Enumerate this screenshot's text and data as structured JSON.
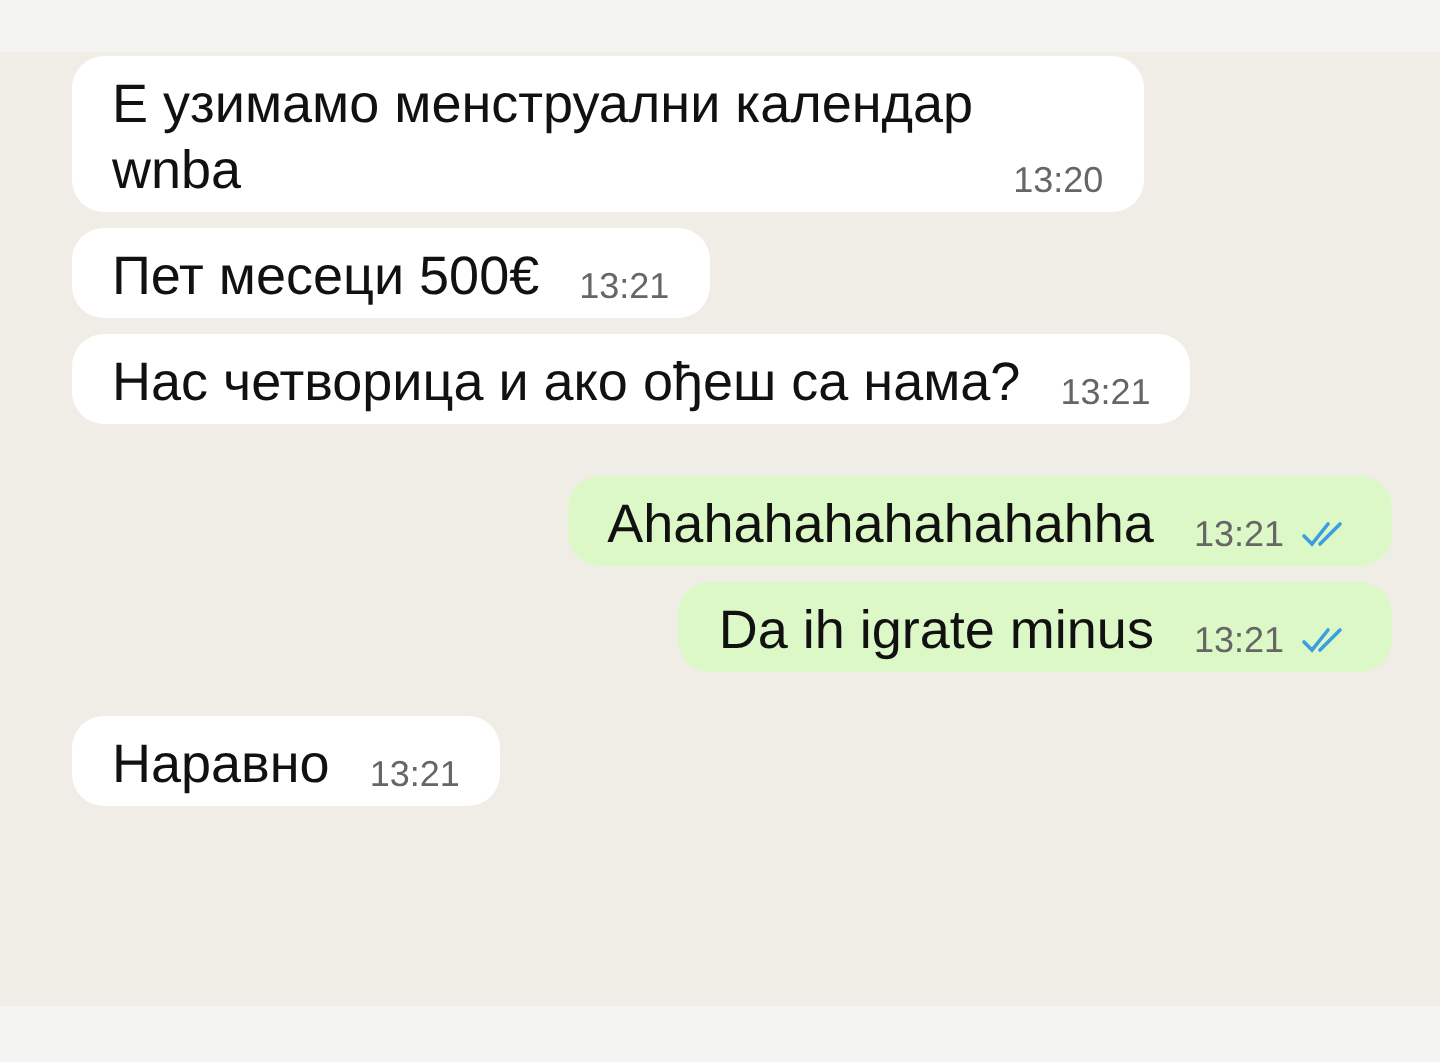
{
  "messages": [
    {
      "kind": "incoming",
      "text": "Е узимамо менструални календар\nwnba",
      "time": "13:20"
    },
    {
      "kind": "incoming",
      "text": "Пет месеци 500€",
      "time": "13:21"
    },
    {
      "kind": "incoming",
      "text": "Нас четворица и ако ођеш са нама?",
      "time": "13:21"
    },
    {
      "kind": "outgoing",
      "text": "Ahahahahahahahahha",
      "time": "13:21",
      "read": true
    },
    {
      "kind": "outgoing",
      "text": "Da ih igrate minus",
      "time": "13:21",
      "read": true
    },
    {
      "kind": "incoming",
      "text": "Наравно",
      "time": "13:21"
    }
  ]
}
